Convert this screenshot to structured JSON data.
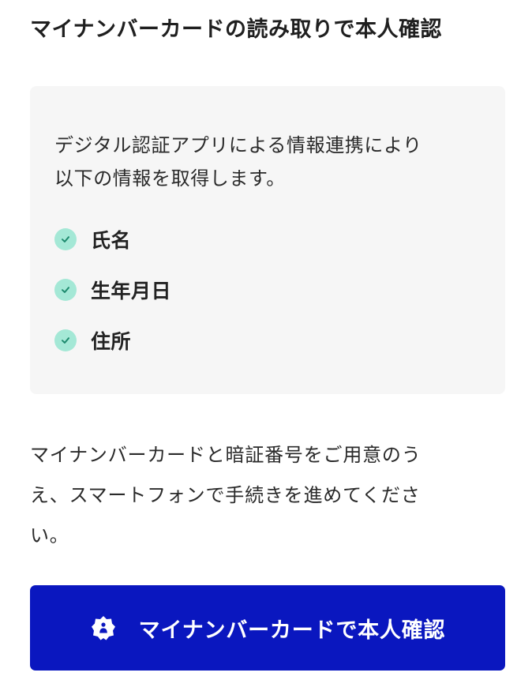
{
  "page": {
    "title": "マイナンバーカードの読み取りで本人確認"
  },
  "info_box": {
    "intro_lines": [
      "デジタル認証アプリによる情報連携により",
      "以下の情報を取得します。"
    ],
    "items": [
      {
        "label": "氏名",
        "icon": "check-icon"
      },
      {
        "label": "生年月日",
        "icon": "check-icon"
      },
      {
        "label": "住所",
        "icon": "check-icon"
      }
    ]
  },
  "description_lines": [
    "マイナンバーカードと暗証番号をご用意のう",
    "え、スマートフォンで手続きを進めてくださ",
    "い。"
  ],
  "cta": {
    "label": "マイナンバーカードで本人確認",
    "icon": "my-number-card-icon"
  },
  "colors": {
    "primary_button": "#0a17bf",
    "check_bg": "#a4e8d6",
    "check_mark": "#1e8a6e",
    "info_box_bg": "#f6f6f6",
    "text": "#222222"
  }
}
